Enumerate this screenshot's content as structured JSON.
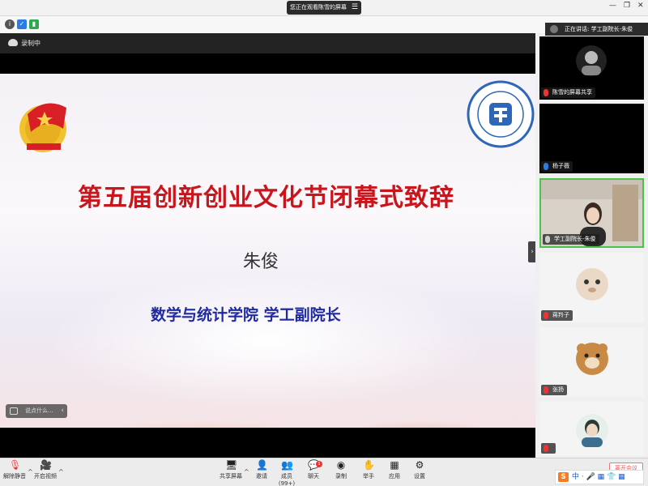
{
  "topbar": {
    "share_notice": "您正在观看陈雪的屏幕",
    "menu_glyph": "☰",
    "min": "—",
    "restore": "❐",
    "close": "✕"
  },
  "recording": {
    "label": "录制中"
  },
  "slide": {
    "title": "第五届创新创业文化节闭幕式致辞",
    "name": "朱俊",
    "subtitle": "数学与统计学院  学工副院长"
  },
  "chat": {
    "placeholder": "说点什么...",
    "collapse": "‹"
  },
  "speaking": {
    "label": "正在讲话: 学工副院长-朱俊"
  },
  "participants": [
    {
      "name": "陈雪的屏幕共享"
    },
    {
      "name": "杨子薇"
    },
    {
      "name": "学工副院长-朱俊"
    },
    {
      "name": "蒋羚子"
    },
    {
      "name": "张扬"
    },
    {
      "name": ""
    }
  ],
  "toolbar": {
    "mute": "解除静音",
    "video": "开启视频",
    "share": "共享屏幕",
    "invite": "邀请",
    "members": "成员(99+)",
    "chat": "聊天",
    "chat_badge": "1",
    "record": "录制",
    "raise_hand": "举手",
    "apps": "应用",
    "settings": "设置"
  },
  "ime": {
    "logo": "S",
    "text": "中 · 🎤 ▦ 👕 ▦",
    "button": "离开会议"
  },
  "colors": {
    "title_red": "#c8161d",
    "subtitle_blue": "#1f2aa0",
    "active_green": "#4cc24c"
  }
}
